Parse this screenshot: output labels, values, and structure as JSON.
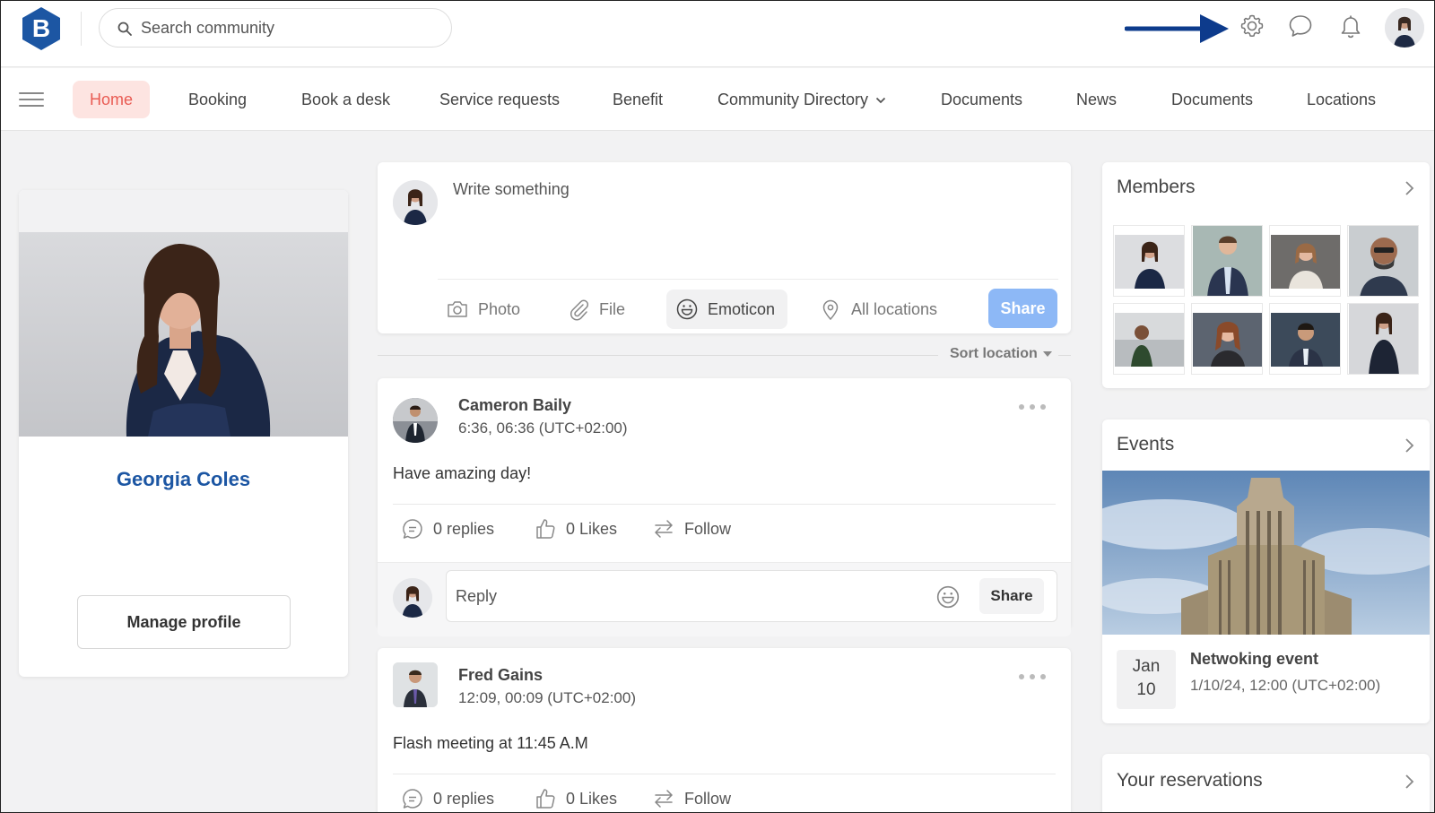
{
  "header": {
    "logo_letter": "B",
    "search_placeholder": "Search community",
    "icons": [
      "gear-icon",
      "chat-icon",
      "bell-icon"
    ]
  },
  "nav": {
    "items": [
      {
        "label": "Home",
        "active": true
      },
      {
        "label": "Booking"
      },
      {
        "label": "Book a desk"
      },
      {
        "label": "Service requests"
      },
      {
        "label": "Benefit"
      },
      {
        "label": "Community Directory",
        "dropdown": true
      },
      {
        "label": "Documents"
      },
      {
        "label": "News"
      },
      {
        "label": "Documents"
      },
      {
        "label": "Locations"
      }
    ]
  },
  "profile": {
    "name": "Georgia Coles",
    "manage_label": "Manage profile"
  },
  "composer": {
    "placeholder": "Write something",
    "photo_label": "Photo",
    "file_label": "File",
    "emoticon_label": "Emoticon",
    "location_label": "All locations",
    "share_label": "Share"
  },
  "feed": {
    "sort_label": "Sort location",
    "posts": [
      {
        "author": "Cameron Baily",
        "time": "6:36, 06:36 (UTC+02:00)",
        "text": "Have amazing day!",
        "replies": "0 replies",
        "likes": "0 Likes",
        "follow": "Follow",
        "reply_placeholder": "Reply",
        "reply_share": "Share"
      },
      {
        "author": "Fred Gains",
        "time": "12:09, 00:09 (UTC+02:00)",
        "text": "Flash meeting at 11:45 A.M",
        "replies": "0 replies",
        "likes": "0 Likes",
        "follow": "Follow"
      }
    ]
  },
  "sidebar": {
    "members_title": "Members",
    "events_title": "Events",
    "event": {
      "month": "Jan",
      "day": "10",
      "title": "Netwoking event",
      "time": "1/10/24, 12:00 (UTC+02:00)"
    },
    "reservations_title": "Your reservations"
  },
  "colors": {
    "brand_blue": "#1c56a3",
    "home_active_bg": "#fde4e1",
    "home_active_text": "#e95b53",
    "share_button": "#8db8f6",
    "arrow": "#0d3b8c"
  }
}
